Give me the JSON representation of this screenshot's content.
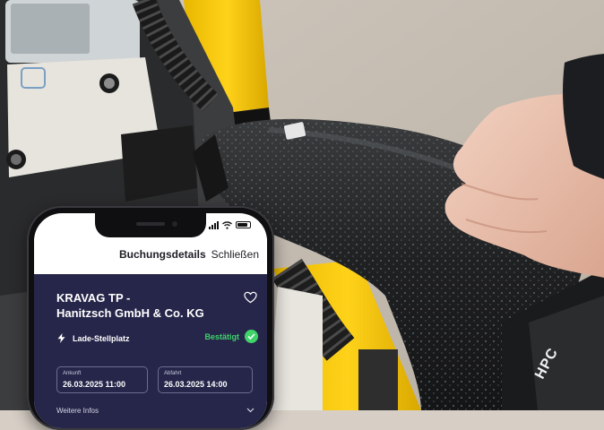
{
  "header": {
    "title": "Buchungsdetails",
    "close_label": "Schließen"
  },
  "booking": {
    "station_name": "KRAVAG TP -\nHanitzsch GmbH & Co. KG",
    "type_label": "Lade-Stellplatz",
    "status_label": "Bestätigt",
    "arrival_label": "Ankunft",
    "arrival_value": "26.03.2025 11:00",
    "departure_label": "Abfahrt",
    "departure_value": "26.03.2025 14:00",
    "more_info_label": "Weitere Infos"
  },
  "connector": {
    "label": "HPC"
  },
  "icons": {
    "favorite": "heart-icon",
    "charging": "bolt-icon",
    "confirmed": "check-circle-icon",
    "expand": "chevron-down-icon"
  },
  "colors": {
    "card_background": "#26264a",
    "confirmed_green": "#3fd36a",
    "charger_yellow": "#f2c200"
  }
}
